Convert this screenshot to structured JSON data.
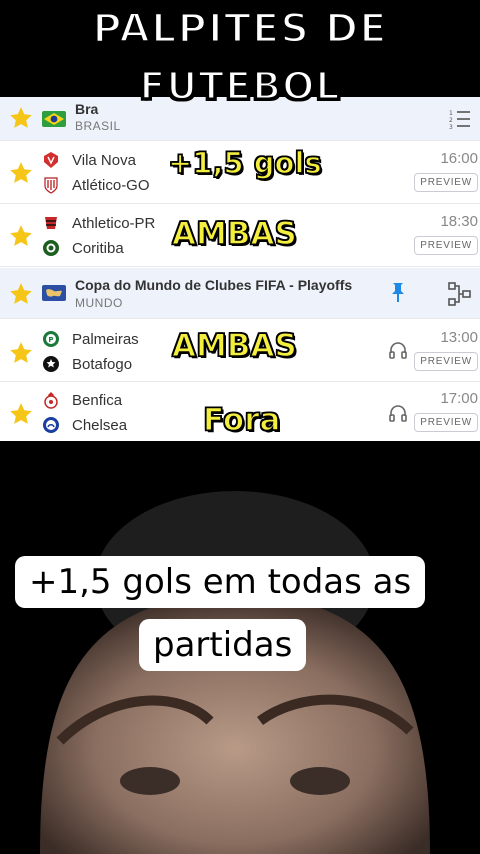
{
  "title": {
    "line1": "PALPITES DE",
    "line2": "FUTEBOL"
  },
  "leagues": [
    {
      "name": "Bra",
      "country": "BRASIL"
    },
    {
      "name": "Copa do Mundo de Clubes FIFA - Playoffs",
      "country": "MUNDO"
    }
  ],
  "matches": [
    {
      "home": "Vila Nova",
      "away": "Atlético-GO",
      "time": "16:00",
      "preview": "PREVIEW",
      "tip": "+1,5 gols"
    },
    {
      "home": "Athletico-PR",
      "away": "Coritiba",
      "time": "18:30",
      "preview": "PREVIEW",
      "tip": "AMBAS"
    },
    {
      "home": "Palmeiras",
      "away": "Botafogo",
      "time": "13:00",
      "preview": "PREVIEW",
      "tip": "AMBAS"
    },
    {
      "home": "Benfica",
      "away": "Chelsea",
      "time": "17:00",
      "preview": "PREVIEW",
      "tip": "Fora"
    }
  ],
  "caption": {
    "line1": "+1,5 gols em todas as",
    "line2": "partidas"
  },
  "colors": {
    "star": "#f5c518",
    "tip": "#f4ef3f",
    "league_bg": "#eef3fb",
    "pin": "#1e88e5"
  }
}
